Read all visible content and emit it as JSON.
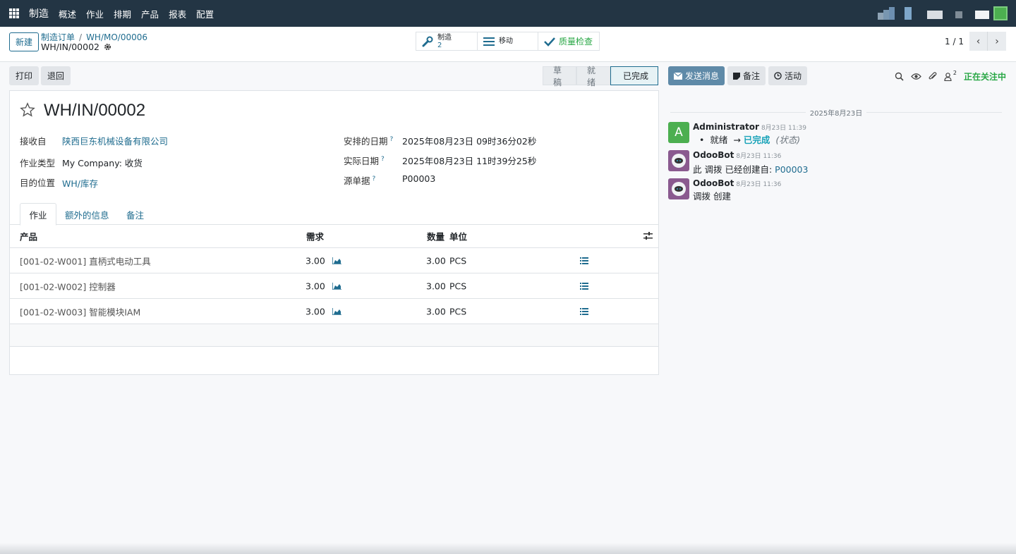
{
  "navbar": {
    "app_name": "制造",
    "menu": [
      "概述",
      "作业",
      "排期",
      "产品",
      "报表",
      "配置"
    ]
  },
  "control_panel": {
    "new_button": "新建",
    "breadcrumb": [
      "制造订单",
      "WH/MO/00006"
    ],
    "record_name": "WH/IN/00002",
    "smart_buttons": {
      "manufacture_label": "制造",
      "manufacture_count": "2",
      "moves_label": "移动",
      "quality_label": "质量检查"
    },
    "pager": "1 / 1"
  },
  "actions": {
    "print": "打印",
    "return": "退回"
  },
  "statusbar": [
    "草稿",
    "就绪",
    "已完成"
  ],
  "form": {
    "title": "WH/IN/00002",
    "fields_left": [
      {
        "label": "接收自",
        "value": "陕西巨东机械设备有限公司"
      },
      {
        "label": "作业类型",
        "value": "My Company: 收货"
      },
      {
        "label": "目的位置",
        "value": "WH/库存"
      }
    ],
    "fields_right": [
      {
        "label": "安排的日期",
        "value": "2025年08月23日 09时36分02秒"
      },
      {
        "label": "实际日期",
        "value": "2025年08月23日 11时39分25秒"
      },
      {
        "label": "源单据",
        "value": "P00003"
      }
    ],
    "help_mark": "?",
    "tabs": [
      "作业",
      "额外的信息",
      "备注"
    ],
    "table": {
      "headers": {
        "product": "产品",
        "demand": "需求",
        "quantity": "数量",
        "uom": "单位"
      },
      "rows": [
        {
          "product": "[001-02-W001] 直柄式电动工具",
          "demand": "3.00",
          "quantity": "3.00",
          "uom": "PCS"
        },
        {
          "product": "[001-02-W002] 控制器",
          "demand": "3.00",
          "quantity": "3.00",
          "uom": "PCS"
        },
        {
          "product": "[001-02-W003] 智能模块IAM",
          "demand": "3.00",
          "quantity": "3.00",
          "uom": "PCS"
        }
      ]
    }
  },
  "chatter": {
    "send_message": "发送消息",
    "log_note": "备注",
    "activity": "活动",
    "followers_count": "2",
    "following": "正在关注中",
    "date_separator": "2025年8月23日",
    "messages": [
      {
        "avatar_letter": "A",
        "author": "Administrator",
        "date": "8月23日 11:39",
        "old_state": "就绪",
        "arrow": "→",
        "new_state": "已完成",
        "field": "(状态)"
      },
      {
        "author": "OdooBot",
        "date": "8月23日 11:36",
        "body": "此 调拨 已经创建自:",
        "link": "P00003"
      },
      {
        "author": "OdooBot",
        "date": "8月23日 11:36",
        "body": "调拨 创建"
      }
    ]
  },
  "colors": {
    "navbar": "#233544",
    "link": "#1f6c8f",
    "success": "#28a745",
    "primary_button": "#5f8aa8"
  }
}
